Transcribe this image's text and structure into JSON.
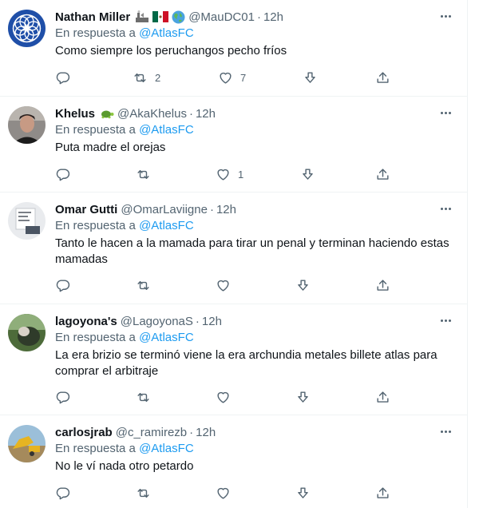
{
  "colors": {
    "accent": "#1d9bf0",
    "secondary_text": "#536471",
    "primary_text": "#0f1419",
    "divider": "#eff3f4"
  },
  "tweets": [
    {
      "name": "Nathan Miller",
      "emojis": [
        "factory-emoji",
        "mexico-flag-emoji",
        "globe-emoji"
      ],
      "handle": "@MauDC01",
      "time": "12h",
      "reply_prefix": "En respuesta a",
      "reply_to": "@AtlasFC",
      "text": "Como siempre los peruchangos pecho fríos",
      "retweets": "2",
      "likes": "7"
    },
    {
      "name": "Khelus",
      "emojis": [
        "turtle-emoji"
      ],
      "handle": "@AkaKhelus",
      "time": "12h",
      "reply_prefix": "En respuesta a",
      "reply_to": "@AtlasFC",
      "text": "Puta madre el orejas",
      "retweets": "",
      "likes": "1"
    },
    {
      "name": "Omar Gutti",
      "emojis": [],
      "handle": "@OmarLaviigne",
      "time": "12h",
      "reply_prefix": "En respuesta a",
      "reply_to": "@AtlasFC",
      "text": "Tanto le hacen a la mamada para tirar un penal y terminan haciendo estas mamadas",
      "retweets": "",
      "likes": ""
    },
    {
      "name": "lagoyona's",
      "emojis": [],
      "handle": "@LagoyonaS",
      "time": "12h",
      "reply_prefix": "En respuesta a",
      "reply_to": "@AtlasFC",
      "text": "La era brizio se terminó viene la era archundia metales billete atlas para comprar el arbitraje",
      "retweets": "",
      "likes": ""
    },
    {
      "name": "carlosjrab",
      "emojis": [],
      "handle": "@c_ramirezb",
      "time": "12h",
      "reply_prefix": "En respuesta a",
      "reply_to": "@AtlasFC",
      "text": "No le ví nada otro petardo",
      "retweets": "",
      "likes": ""
    }
  ]
}
